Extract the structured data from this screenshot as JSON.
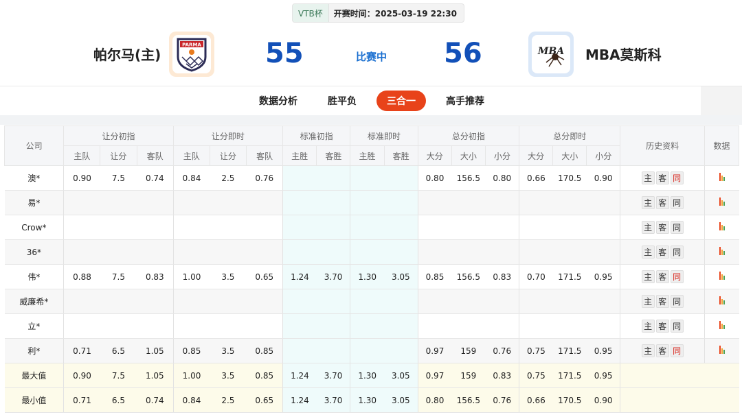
{
  "header": {
    "cup": "VTB杯",
    "start_time": "开赛时间：2025-03-19 22:30",
    "home": {
      "name": "帕尔马(主)",
      "score": "55",
      "logo_text": "PARMA"
    },
    "away": {
      "name": "MBA莫斯科",
      "score": "56",
      "logo_text": "MBA"
    },
    "status": "比赛中"
  },
  "tabs": [
    {
      "label": "数据分析",
      "active": false
    },
    {
      "label": "胜平负",
      "active": false
    },
    {
      "label": "三合一",
      "active": true
    },
    {
      "label": "高手推荐",
      "active": false
    }
  ],
  "colors": {
    "accent": "#e8431a",
    "score": "#1250b8",
    "live": "#1a55a8",
    "red": "#d8261d"
  },
  "table": {
    "headers": {
      "company": "公司",
      "groups": [
        "让分初指",
        "让分即时",
        "标准初指",
        "标准即时",
        "总分初指",
        "总分即时"
      ],
      "history": "历史资料",
      "data": "数据",
      "sub": [
        "主队",
        "让分",
        "客队",
        "主队",
        "让分",
        "客队",
        "主胜",
        "客胜",
        "主胜",
        "客胜",
        "大分",
        "大小",
        "小分",
        "大分",
        "大小",
        "小分"
      ]
    },
    "history_labels": [
      "主",
      "客",
      "同"
    ],
    "rows": [
      {
        "company": "澳*",
        "cells": [
          "0.90",
          "7.5",
          "0.74",
          "0.84",
          "2.5",
          "0.76",
          "",
          "",
          "",
          "",
          "0.80",
          "156.5",
          "0.80",
          "0.66",
          "170.5",
          "0.90"
        ],
        "same_red": true
      },
      {
        "company": "易*",
        "cells": [
          "",
          "",
          "",
          "",
          "",
          "",
          "",
          "",
          "",
          "",
          "",
          "",
          "",
          "",
          "",
          ""
        ],
        "same_red": false
      },
      {
        "company": "Crow*",
        "cells": [
          "",
          "",
          "",
          "",
          "",
          "",
          "",
          "",
          "",
          "",
          "",
          "",
          "",
          "",
          "",
          ""
        ],
        "same_red": false
      },
      {
        "company": "36*",
        "cells": [
          "",
          "",
          "",
          "",
          "",
          "",
          "",
          "",
          "",
          "",
          "",
          "",
          "",
          "",
          "",
          ""
        ],
        "same_red": false
      },
      {
        "company": "伟*",
        "cells": [
          "0.88",
          "7.5",
          "0.83",
          "1.00",
          "3.5",
          "0.65",
          "1.24",
          "3.70",
          "1.30",
          "3.05",
          "0.85",
          "156.5",
          "0.83",
          "0.70",
          "171.5",
          "0.95"
        ],
        "same_red": true
      },
      {
        "company": "威廉希*",
        "cells": [
          "",
          "",
          "",
          "",
          "",
          "",
          "",
          "",
          "",
          "",
          "",
          "",
          "",
          "",
          "",
          ""
        ],
        "same_red": false
      },
      {
        "company": "立*",
        "cells": [
          "",
          "",
          "",
          "",
          "",
          "",
          "",
          "",
          "",
          "",
          "",
          "",
          "",
          "",
          "",
          ""
        ],
        "same_red": false
      },
      {
        "company": "利*",
        "cells": [
          "0.71",
          "6.5",
          "1.05",
          "0.85",
          "3.5",
          "0.85",
          "",
          "",
          "",
          "",
          "0.97",
          "159",
          "0.76",
          "0.75",
          "171.5",
          "0.95"
        ],
        "same_red": true
      }
    ],
    "summary": [
      {
        "label": "最大值",
        "cells": [
          "0.90",
          "7.5",
          "1.05",
          "1.00",
          "3.5",
          "0.85",
          "1.24",
          "3.70",
          "1.30",
          "3.05",
          "0.97",
          "159",
          "0.83",
          "0.75",
          "171.5",
          "0.95"
        ]
      },
      {
        "label": "最小值",
        "cells": [
          "0.71",
          "6.5",
          "0.74",
          "0.84",
          "2.5",
          "0.65",
          "1.24",
          "3.70",
          "1.30",
          "3.05",
          "0.80",
          "156.5",
          "0.76",
          "0.66",
          "170.5",
          "0.90"
        ]
      }
    ]
  }
}
